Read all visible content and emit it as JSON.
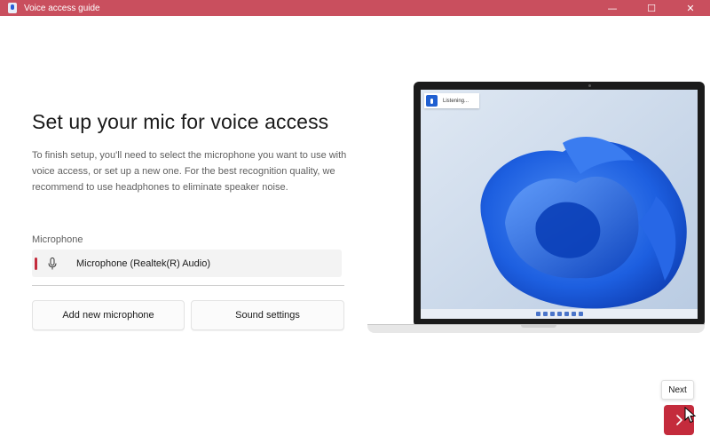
{
  "window": {
    "title": "Voice access guide",
    "controls": {
      "minimize": "—",
      "maximize": "☐",
      "close": "✕"
    },
    "accent_color": "#c94f5e"
  },
  "main": {
    "heading": "Set up your mic for voice access",
    "description": "To finish setup, you'll need to select the microphone you want to use with voice access, or set up a new one. For the best recognition quality, we recommend to use headphones to eliminate speaker noise.",
    "microphone_label": "Microphone",
    "microphone_value": "Microphone (Realtek(R) Audio)",
    "add_button": "Add new microphone",
    "sound_button": "Sound settings"
  },
  "illustration": {
    "voice_bar_text": "Listening..."
  },
  "footer": {
    "next_tooltip": "Next",
    "next_button_color": "#c42b3c"
  },
  "icons": [
    "app-icon",
    "microphone-icon",
    "chevron-right-icon",
    "mouse-cursor-icon"
  ]
}
